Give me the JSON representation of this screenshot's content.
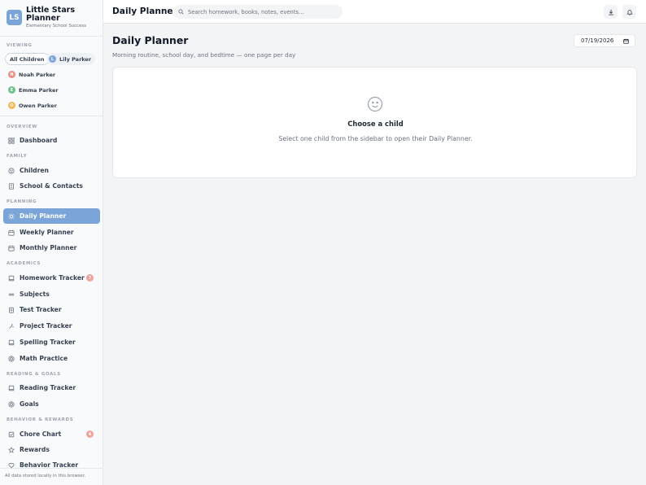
{
  "brand": {
    "initials": "LS",
    "name": "Little Stars Planner",
    "subtitle": "Elementary School Success",
    "logo_color": "#7ba4d8"
  },
  "viewing": {
    "label": "Viewing",
    "all_label": "All Children",
    "children": [
      {
        "initial": "L",
        "name": "Lily Parker",
        "color": "#7ba4d8"
      },
      {
        "initial": "N",
        "name": "Noah Parker",
        "color": "#ee8e82"
      },
      {
        "initial": "E",
        "name": "Emma Parker",
        "color": "#6fc08d"
      },
      {
        "initial": "O",
        "name": "Owen Parker",
        "color": "#f2b94f"
      }
    ]
  },
  "nav": {
    "sections": [
      {
        "label": "Overview",
        "items": [
          {
            "label": "Dashboard",
            "icon": "grid-icon"
          }
        ]
      },
      {
        "label": "Family",
        "items": [
          {
            "label": "Children",
            "icon": "smile-icon"
          },
          {
            "label": "School & Contacts",
            "icon": "building-icon"
          }
        ]
      },
      {
        "label": "Planning",
        "items": [
          {
            "label": "Daily Planner",
            "icon": "sun-icon",
            "active": true
          },
          {
            "label": "Weekly Planner",
            "icon": "calendar-icon"
          },
          {
            "label": "Monthly Planner",
            "icon": "calendar-icon"
          }
        ]
      },
      {
        "label": "Academics",
        "items": [
          {
            "label": "Homework Tracker",
            "icon": "book-icon",
            "badge": "7"
          },
          {
            "label": "Subjects",
            "icon": "layers-icon"
          },
          {
            "label": "Test Tracker",
            "icon": "clipboard-icon"
          },
          {
            "label": "Project Tracker",
            "icon": "sparkle-icon"
          },
          {
            "label": "Spelling Tracker",
            "icon": "book-icon"
          },
          {
            "label": "Math Practice",
            "icon": "target-icon"
          }
        ]
      },
      {
        "label": "Reading & Goals",
        "items": [
          {
            "label": "Reading Tracker",
            "icon": "book-open-icon"
          },
          {
            "label": "Goals",
            "icon": "target-icon"
          }
        ]
      },
      {
        "label": "Behavior & Rewards",
        "items": [
          {
            "label": "Chore Chart",
            "icon": "check-square-icon",
            "badge": "4"
          },
          {
            "label": "Rewards",
            "icon": "star-icon"
          },
          {
            "label": "Behavior Tracker",
            "icon": "heart-icon"
          }
        ]
      }
    ]
  },
  "sidebar_footer": "All data stored locally in this browser.",
  "topbar": {
    "title": "Daily Planner",
    "search_placeholder": "Search homework, books, notes, events...",
    "download_icon": "download-icon",
    "bell_icon": "bell-icon"
  },
  "main": {
    "title": "Daily Planner",
    "subtitle": "Morning routine, school day, and bedtime — one page per day",
    "date": "07/19/2026",
    "empty": {
      "icon": "smile-icon",
      "title": "Choose a child",
      "text": "Select one child from the sidebar to open their Daily Planner."
    }
  },
  "colors": {
    "accent": "#7ba4d8",
    "badge": "#f0a29a"
  }
}
